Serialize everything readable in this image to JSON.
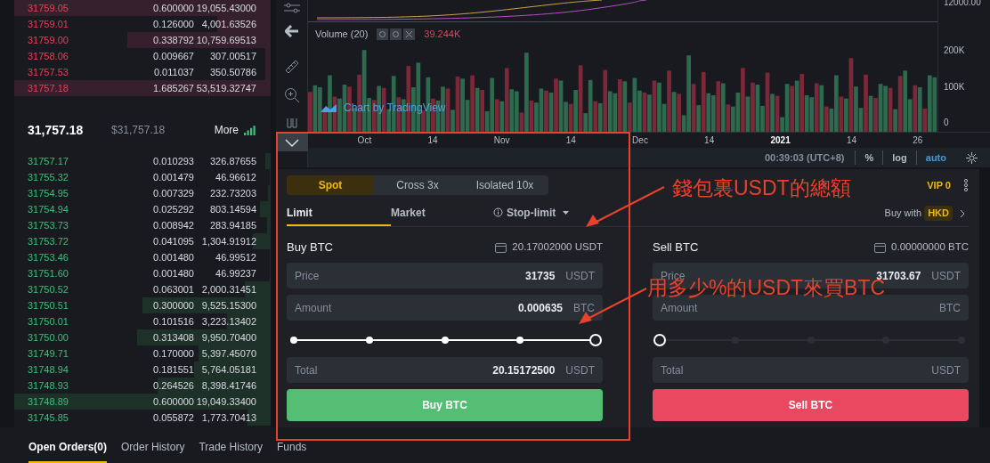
{
  "order_book": {
    "asks": [
      {
        "price": "31759.05",
        "amount": "0.600000",
        "total": "19,055.43000",
        "level": 1.0
      },
      {
        "price": "31759.01",
        "amount": "0.126000",
        "total": "4,001.63526",
        "level": 0.21
      },
      {
        "price": "31759.00",
        "amount": "0.338792",
        "total": "10,759.69513",
        "level": 0.56
      },
      {
        "price": "31758.06",
        "amount": "0.009667",
        "total": "307.00517",
        "level": 0.02
      },
      {
        "price": "31757.53",
        "amount": "0.011037",
        "total": "350.50786",
        "level": 0.02
      },
      {
        "price": "31757.18",
        "amount": "1.685267",
        "total": "53,519.32747",
        "level": 1.0
      }
    ],
    "last_price": "31,757.18",
    "last_price_usd": "$31,757.18",
    "more": "More",
    "bids": [
      {
        "price": "31757.17",
        "amount": "0.010293",
        "total": "326.87655",
        "level": 0.02
      },
      {
        "price": "31755.32",
        "amount": "0.001479",
        "total": "46.96612",
        "level": 0.005
      },
      {
        "price": "31754.95",
        "amount": "0.007329",
        "total": "232.73203",
        "level": 0.01
      },
      {
        "price": "31754.94",
        "amount": "0.025292",
        "total": "803.14594",
        "level": 0.04
      },
      {
        "price": "31753.73",
        "amount": "0.008942",
        "total": "283.94185",
        "level": 0.015
      },
      {
        "price": "31753.72",
        "amount": "0.041095",
        "total": "1,304.91912",
        "level": 0.07
      },
      {
        "price": "31753.46",
        "amount": "0.001480",
        "total": "46.99512",
        "level": 0.005
      },
      {
        "price": "31751.60",
        "amount": "0.001480",
        "total": "46.99237",
        "level": 0.005
      },
      {
        "price": "31750.52",
        "amount": "0.063001",
        "total": "2,000.31451",
        "level": 0.1
      },
      {
        "price": "31750.51",
        "amount": "0.300000",
        "total": "9,525.15300",
        "level": 0.5
      },
      {
        "price": "31750.01",
        "amount": "0.101516",
        "total": "3,223.13402",
        "level": 0.17
      },
      {
        "price": "31750.00",
        "amount": "0.313408",
        "total": "9,950.70400",
        "level": 0.52
      },
      {
        "price": "31749.71",
        "amount": "0.170000",
        "total": "5,397.45070",
        "level": 0.28
      },
      {
        "price": "31748.94",
        "amount": "0.181551",
        "total": "5,764.05181",
        "level": 0.3
      },
      {
        "price": "31748.93",
        "amount": "0.264526",
        "total": "8,398.41746",
        "level": 0.44
      },
      {
        "price": "31748.89",
        "amount": "0.600000",
        "total": "19,049.33400",
        "level": 1.0
      },
      {
        "price": "31745.85",
        "amount": "0.055872",
        "total": "1,773.70413",
        "level": 0.09
      }
    ]
  },
  "chart": {
    "price_axis_label": "12000.00",
    "volume_title": "Volume (20)",
    "volume_value": "39.244K",
    "volume_axis": [
      "200K",
      "100K",
      "0"
    ],
    "watermark": "Chart by TradingView",
    "time_axis": [
      "Oct",
      "14",
      "Nov",
      "14",
      "Dec",
      "14",
      "2021",
      "14",
      "26"
    ],
    "clock": "00:39:03 (UTC+8)",
    "options": [
      {
        "label": "%",
        "selected": false
      },
      {
        "label": "log",
        "selected": false
      },
      {
        "label": "auto",
        "selected": true
      }
    ]
  },
  "trade_form": {
    "modes": [
      {
        "label": "Spot",
        "selected": true
      },
      {
        "label": "Cross",
        "suffix": "3x",
        "selected": false
      },
      {
        "label": "Isolated",
        "suffix": "10x",
        "selected": false
      }
    ],
    "vip": "VIP 0",
    "order_types": [
      {
        "label": "Limit",
        "selected": true
      },
      {
        "label": "Market",
        "selected": false
      },
      {
        "label": "Stop-limit",
        "selected": false
      }
    ],
    "buy_with": "Buy with",
    "buy_with_currency": "HKD",
    "sides": [
      {
        "kind": "buy",
        "title": "Buy BTC",
        "balance": "20.17002000 USDT",
        "fields": [
          {
            "label": "Price",
            "value": "31735",
            "unit": "USDT"
          },
          {
            "label": "Amount",
            "value": "0.000635",
            "unit": "BTC"
          },
          {
            "label": "Total",
            "value": "20.15172500",
            "unit": "USDT"
          }
        ],
        "slider": {
          "level": 1
        },
        "button": "Buy BTC"
      },
      {
        "kind": "sell",
        "title": "Sell BTC",
        "balance": "0.00000000 BTC",
        "fields": [
          {
            "label": "Price",
            "value": "31703.67",
            "unit": "USDT"
          },
          {
            "label": "Amount",
            "unit": "BTC"
          },
          {
            "label": "Total",
            "unit": "USDT"
          }
        ],
        "slider": {
          "level": 0
        },
        "button": "Sell BTC"
      }
    ]
  },
  "bottom_tabs": [
    {
      "label": "Open Orders(0)",
      "selected": true
    },
    {
      "label": "Order History",
      "selected": false
    },
    {
      "label": "Trade History",
      "selected": false
    },
    {
      "label": "Funds",
      "selected": false
    }
  ],
  "annotations": [
    {
      "text": "錢包裏USDT的總額"
    },
    {
      "text": "用多少%的USDT來買BTC"
    }
  ]
}
